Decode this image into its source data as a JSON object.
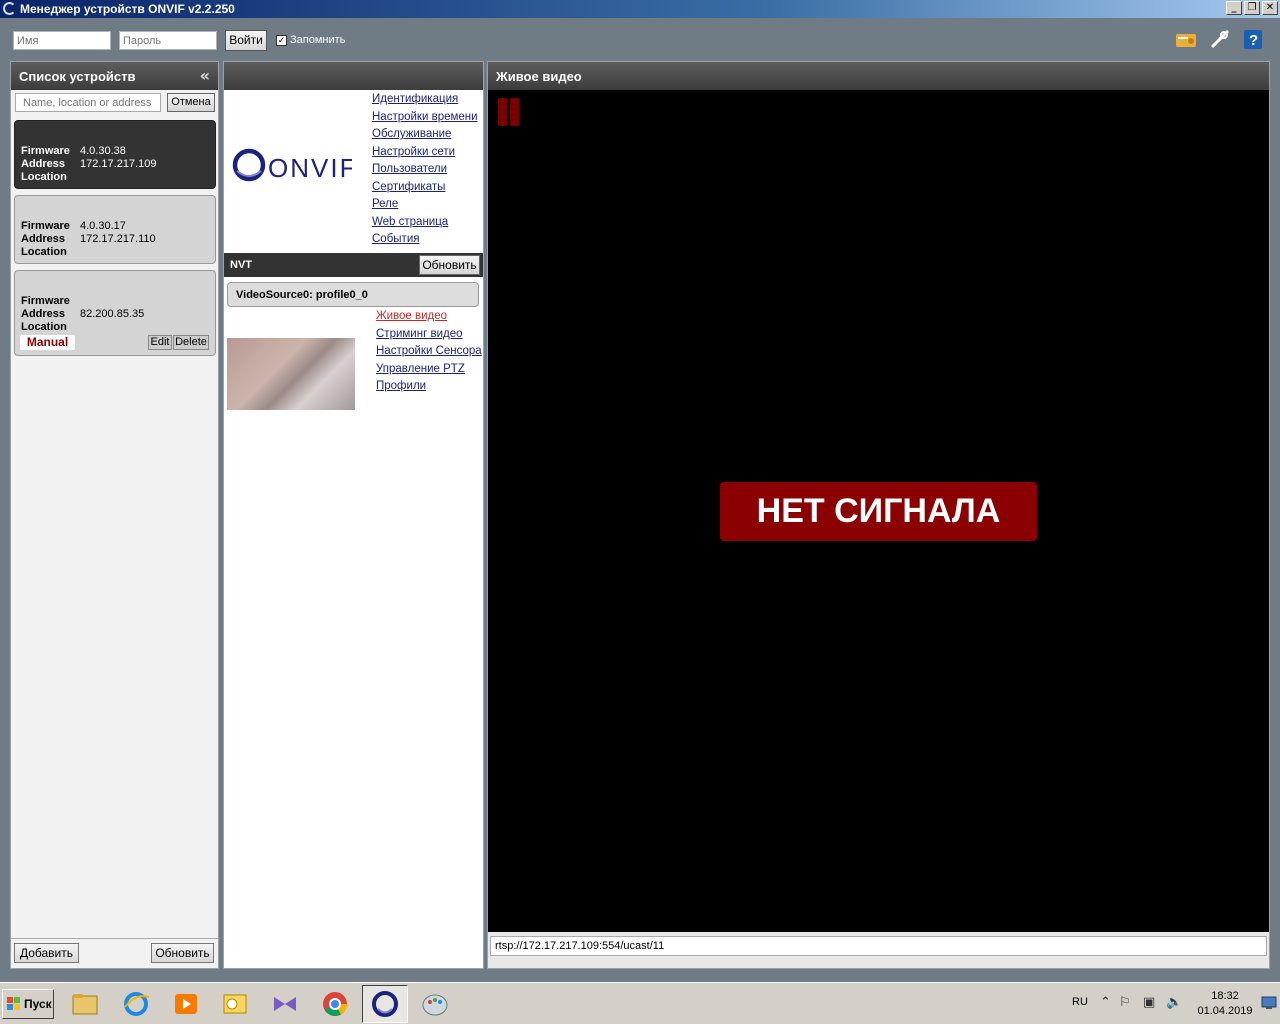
{
  "window": {
    "title": "Менеджер устройств ONVIF v2.2.250"
  },
  "toolbar": {
    "name_placeholder": "Имя",
    "password_placeholder": "Пароль",
    "login_label": "Войти",
    "remember_label": "Запомнить",
    "remember_checked": "✓"
  },
  "device_list": {
    "title": "Список устройств",
    "collapse_glyph": "«",
    "search_placeholder": "Name, location or address",
    "cancel_label": "Отмена",
    "labels": {
      "firmware": "Firmware",
      "address": "Address",
      "location": "Location"
    },
    "devices": [
      {
        "firmware": "4.0.30.38",
        "address": "172.17.217.109",
        "location": ""
      },
      {
        "firmware": "4.0.30.17",
        "address": "172.17.217.110",
        "location": ""
      },
      {
        "firmware": "",
        "address": "82.200.85.35",
        "location": "",
        "badge": "Manual",
        "edit": "Edit",
        "delete": "Delete"
      }
    ],
    "add_label": "Добавить",
    "refresh_label": "Обновить"
  },
  "device_panel": {
    "logo_text": "ONVIF",
    "links": [
      "Идентификация",
      "Настройки времени",
      "Обслуживание",
      "Настройки сети",
      "Пользователи",
      "Сертификаты",
      "Реле",
      "Web страница",
      "События"
    ],
    "nvt_label": "NVT",
    "nvt_refresh": "Обновить",
    "video_source": "VideoSource0: profile0_0",
    "video_links": [
      "Живое видео",
      "Стриминг видео",
      "Настройки Сенсора",
      "Управление PTZ",
      "Профили"
    ]
  },
  "live_video": {
    "title": "Живое видео",
    "no_signal": "НЕТ СИГНАЛА",
    "stream_url": "rtsp://172.17.217.109:554/ucast/11"
  },
  "taskbar": {
    "start_label": "Пуск",
    "lang": "RU",
    "time": "18:32",
    "date": "01.04.2019"
  },
  "colors": {
    "accent_red": "#8b0000",
    "panel_header": "#3c3c3c",
    "link": "#1a237e"
  }
}
